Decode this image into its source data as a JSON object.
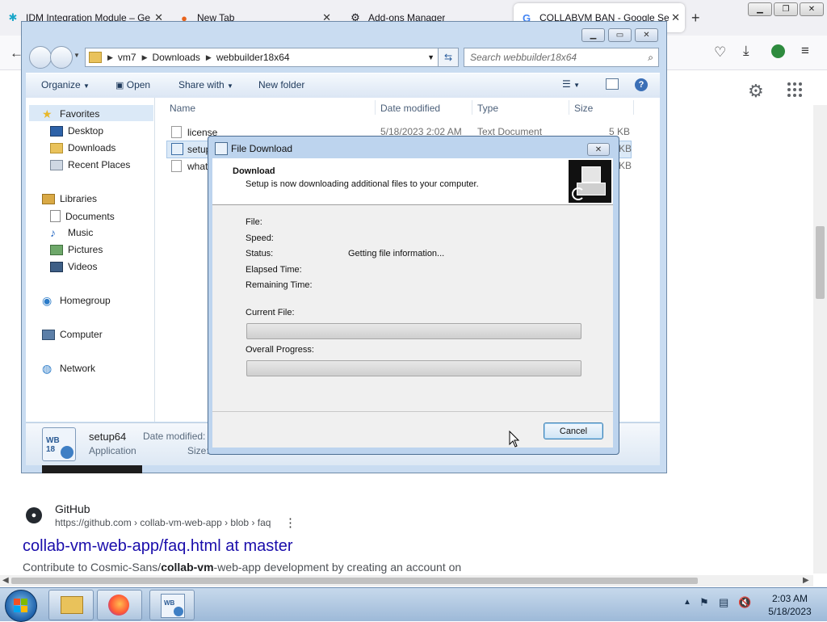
{
  "browser": {
    "tabs": [
      {
        "label": "IDM Integration Module – Ge",
        "icon": "idm-icon"
      },
      {
        "label": "New Tab",
        "icon": "firefox-icon"
      },
      {
        "label": "Add-ons Manager",
        "icon": "puzzle-icon"
      },
      {
        "label": "COLLABVM BAN - Google Se",
        "icon": "google-icon",
        "active": true
      }
    ],
    "new_tab_symbol": "+",
    "toolbar_icons": [
      "pocket-icon",
      "download-icon",
      "extension-icon",
      "menu-icon"
    ]
  },
  "google_result": {
    "site_name": "GitHub",
    "url": "https://github.com › collab-vm-web-app › blob › faq",
    "title": "collab-vm-web-app/faq.html at master",
    "snippet_prefix": "Contribute to Cosmic-Sans/",
    "snippet_bold": "collab-vm",
    "snippet_suffix": "-web-app development by creating an account on"
  },
  "explorer": {
    "breadcrumb": [
      "vm7",
      "Downloads",
      "webbuilder18x64"
    ],
    "search_placeholder": "Search webbuilder18x64",
    "toolbar": {
      "organize": "Organize",
      "open": "Open",
      "share_with": "Share with",
      "new_folder": "New folder"
    },
    "nav": {
      "favorites": "Favorites",
      "desktop": "Desktop",
      "downloads": "Downloads",
      "recent_places": "Recent Places",
      "libraries": "Libraries",
      "documents": "Documents",
      "music": "Music",
      "pictures": "Pictures",
      "videos": "Videos",
      "homegroup": "Homegroup",
      "computer": "Computer",
      "network": "Network"
    },
    "columns": {
      "name": "Name",
      "date_modified": "Date modified",
      "type": "Type",
      "size": "Size"
    },
    "files": [
      {
        "name": "license",
        "date": "5/18/2023 2:02 AM",
        "type": "Text Document",
        "size": "5 KB"
      },
      {
        "name": "setup",
        "date": "",
        "type": "",
        "size": "KB"
      },
      {
        "name": "what",
        "date": "",
        "type": "",
        "size": "KB"
      }
    ],
    "details": {
      "name": "setup64",
      "type": "Application",
      "date_label": "Date modified:",
      "size_label": "Size:"
    }
  },
  "dialog": {
    "title": "File Download",
    "heading": "Download",
    "subheading": "Setup is now downloading additional files to your computer.",
    "file_label": "File:",
    "speed_label": "Speed:",
    "status_label": "Status:",
    "status_value": "Getting file information...",
    "elapsed_label": "Elapsed Time:",
    "remaining_label": "Remaining Time:",
    "current_file_label": "Current File:",
    "overall_label": "Overall Progress:",
    "current_progress": 0,
    "overall_progress": 0,
    "cancel_label": "Cancel"
  },
  "taskbar": {
    "time": "2:03 AM",
    "date": "5/18/2023"
  }
}
